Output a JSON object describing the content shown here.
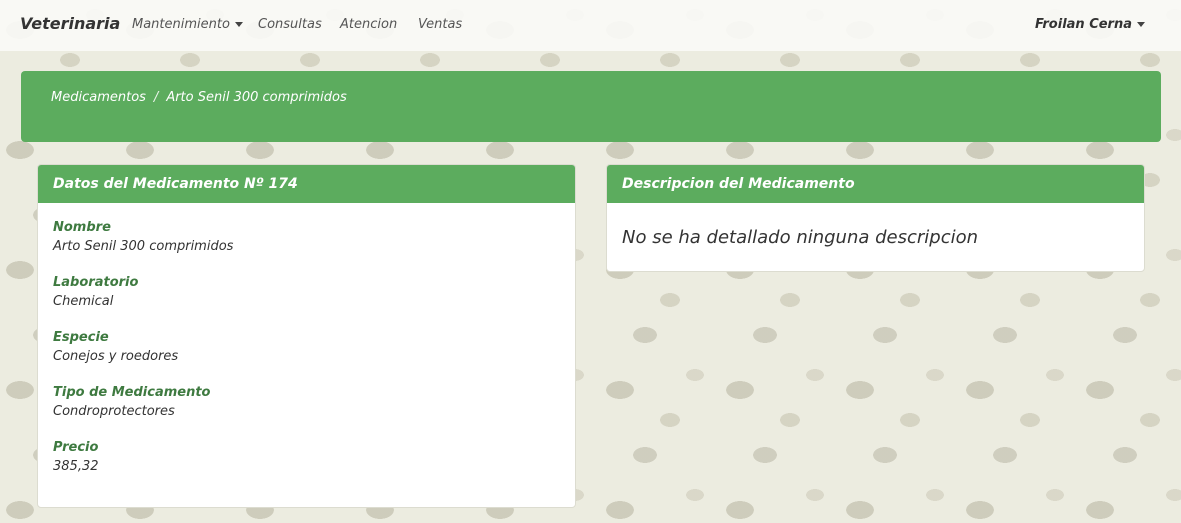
{
  "navbar": {
    "brand": "Veterinaria",
    "items": [
      {
        "label": "Mantenimiento"
      },
      {
        "label": "Consultas"
      },
      {
        "label": "Atencion"
      },
      {
        "label": "Ventas"
      }
    ],
    "user": "Froilan Cerna"
  },
  "breadcrumb": {
    "parent": "Medicamentos",
    "separator": "/",
    "current": "Arto Senil 300 comprimidos"
  },
  "details_panel": {
    "title": "Datos del Medicamento Nº 174",
    "fields": [
      {
        "label": "Nombre",
        "value": "Arto Senil 300 comprimidos"
      },
      {
        "label": "Laboratorio",
        "value": "Chemical"
      },
      {
        "label": "Especie",
        "value": "Conejos y roedores"
      },
      {
        "label": "Tipo de Medicamento",
        "value": "Condroprotectores"
      },
      {
        "label": "Precio",
        "value": "385,32"
      }
    ]
  },
  "description_panel": {
    "title": "Descripcion del Medicamento",
    "text": "No se ha detallado ninguna descripcion"
  },
  "colors": {
    "accent_green": "#5cac5e",
    "label_green": "#3e7a40"
  }
}
